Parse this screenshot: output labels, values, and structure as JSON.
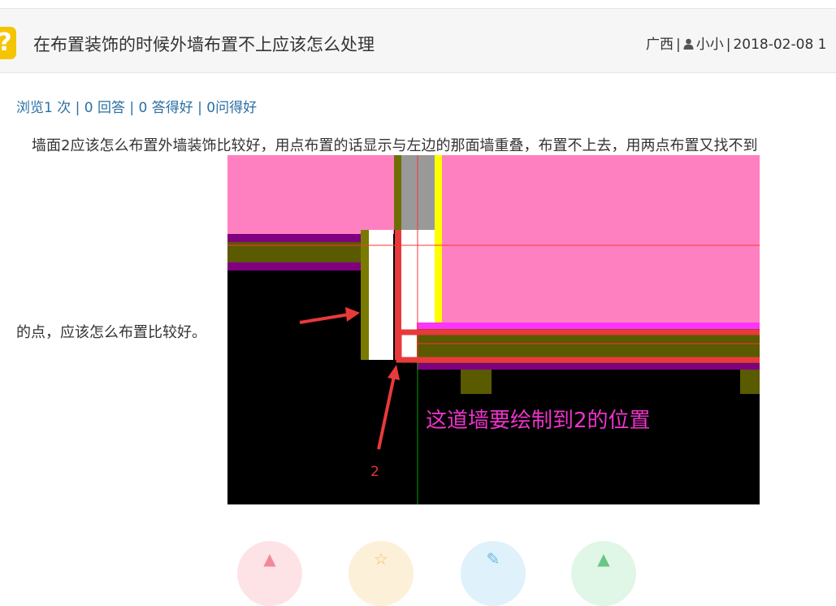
{
  "question": {
    "title": "在布置装饰的时候外墙布置不上应该怎么处理",
    "location": "广西",
    "user": "小小",
    "date": "2018-02-08 1"
  },
  "stats": {
    "text": "浏览1 次 | 0 回答 | 0 答得好 | 0问得好"
  },
  "body": {
    "line1": "墙面2应该怎么布置外墙装饰比较好，用点布置的话显示与左边的那面墙重叠，布置不上去，用两点布置又找不到",
    "line2": "的点，应该怎么布置比较好。"
  },
  "image": {
    "annotation": "这道墙要绘制到2的位置",
    "marker": "2"
  },
  "actions": [
    {
      "name": "like",
      "icon": "thumb-up-icon",
      "color": "#fde3e6",
      "glyph_color": "#f08a9a"
    },
    {
      "name": "favorite",
      "icon": "star-icon",
      "color": "#fdf0d8",
      "glyph_color": "#f3c063"
    },
    {
      "name": "edit",
      "icon": "edit-icon",
      "color": "#dff1fb",
      "glyph_color": "#6cb6df"
    },
    {
      "name": "share",
      "icon": "share-icon",
      "color": "#e0f6e6",
      "glyph_color": "#6bc487"
    }
  ],
  "colors": {
    "stats_link": "#2b6fa3",
    "icon_yellow": "#f5c400",
    "wall_pink": "#ff80c0",
    "annotation_magenta": "#ee33cc",
    "highlight_red": "#e83a3a"
  }
}
